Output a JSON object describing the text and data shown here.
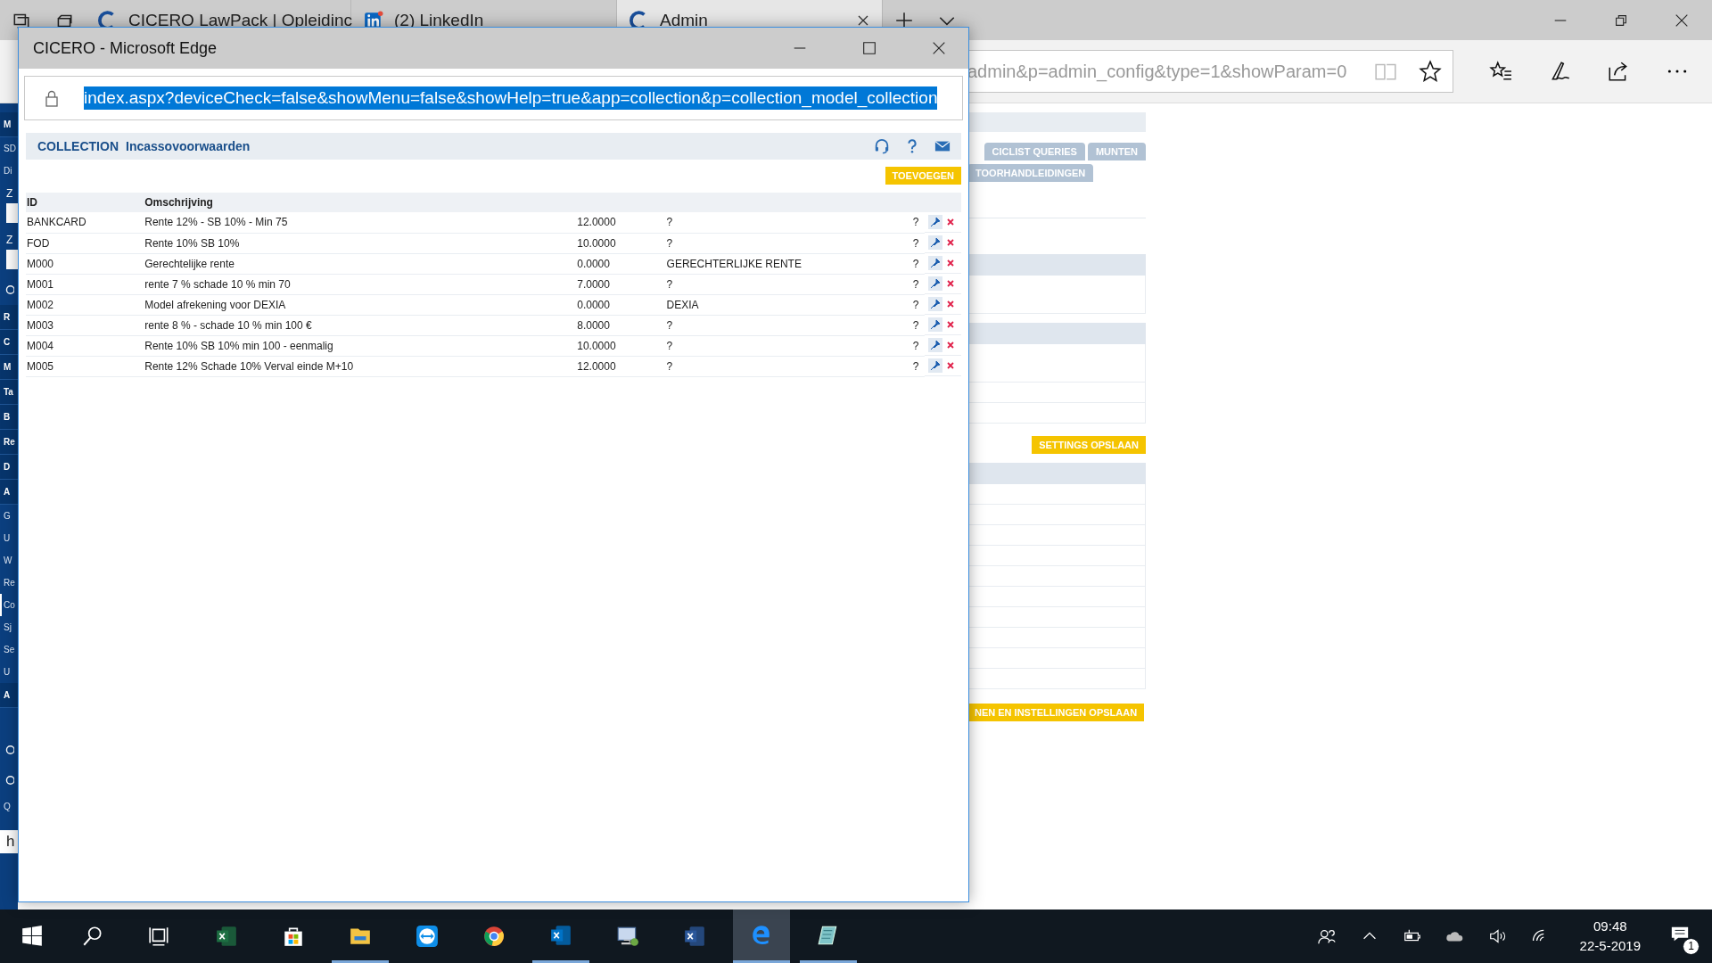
{
  "browser": {
    "tabs": [
      {
        "title": "CICERO LawPack | Opleidinc",
        "selected": false
      },
      {
        "title": "(2) LinkedIn",
        "selected": false
      },
      {
        "title": "Admin",
        "selected": true
      }
    ],
    "address": "admin&p=admin_config&type=1&showParam=0"
  },
  "sidebar": {
    "items": [
      {
        "label": "M",
        "kind": "header"
      },
      {
        "label": "SD",
        "kind": "text"
      },
      {
        "label": "Di",
        "kind": "text"
      },
      {
        "label": "Z",
        "kind": "field"
      },
      {
        "label": "Z",
        "kind": "field"
      },
      {
        "kind": "icon"
      },
      {
        "label": "R",
        "kind": "header"
      },
      {
        "label": "C",
        "kind": "header"
      },
      {
        "label": "M",
        "kind": "header"
      },
      {
        "label": "Ta",
        "kind": "header"
      },
      {
        "label": "B",
        "kind": "header"
      },
      {
        "label": "Re",
        "kind": "header"
      },
      {
        "label": "D",
        "kind": "header"
      },
      {
        "label": "A",
        "kind": "header"
      },
      {
        "label": "G",
        "kind": "text",
        "selected": false
      },
      {
        "label": "U",
        "kind": "text",
        "selected": false
      },
      {
        "label": "W",
        "kind": "text",
        "selected": false
      },
      {
        "label": "Re",
        "kind": "text",
        "selected": false
      },
      {
        "label": "Co",
        "kind": "text",
        "selected": true
      },
      {
        "label": "Sj",
        "kind": "text",
        "selected": false
      },
      {
        "label": "Se",
        "kind": "text",
        "selected": false
      },
      {
        "label": "U",
        "kind": "text",
        "selected": false
      },
      {
        "label": "A",
        "kind": "header"
      },
      {
        "kind": "gap"
      },
      {
        "kind": "icon"
      },
      {
        "kind": "icon"
      },
      {
        "label": "Q",
        "kind": "text"
      },
      {
        "label": "h",
        "kind": "input"
      }
    ]
  },
  "background_page": {
    "tabs": [
      "CICLIST QUERIES",
      "MUNTEN",
      "TOORHANDLEIDINGEN"
    ],
    "save_button": "SETTINGS OPSLAAN",
    "save_all_button": "NEN EN INSTELLINGEN OPSLAAN"
  },
  "popup": {
    "title": "CICERO - Microsoft Edge",
    "url": "index.aspx?deviceCheck=false&showMenu=false&showHelp=true&app=collection&p=collection_model_collection",
    "url_selected": true,
    "heading": {
      "app": "COLLECTION",
      "page": "Incassovoorwaarden"
    },
    "add_button": "TOEVOEGEN",
    "columns": [
      "ID",
      "Omschrijving"
    ],
    "rows": [
      {
        "id": "BANKCARD",
        "description": "Rente 12% - SB 10% - Min 75",
        "rate": "12.0000",
        "column_4": "?",
        "help": "?"
      },
      {
        "id": "FOD",
        "description": "Rente 10% SB 10%",
        "rate": "10.0000",
        "column_4": "?",
        "help": "?"
      },
      {
        "id": "M000",
        "description": "Gerechtelijke rente",
        "rate": "0.0000",
        "column_4": "GERECHTERLIJKE RENTE",
        "help": "?"
      },
      {
        "id": "M001",
        "description": "rente 7 % schade 10 % min 70",
        "rate": "7.0000",
        "column_4": "?",
        "help": "?"
      },
      {
        "id": "M002",
        "description": "Model afrekening voor DEXIA",
        "rate": "0.0000",
        "column_4": "DEXIA",
        "help": "?"
      },
      {
        "id": "M003",
        "description": "rente 8 % - schade 10 % min 100 €",
        "rate": "8.0000",
        "column_4": "?",
        "help": "?"
      },
      {
        "id": "M004",
        "description": "Rente 10% SB 10% min 100 - eenmalig",
        "rate": "10.0000",
        "column_4": "?",
        "help": "?"
      },
      {
        "id": "M005",
        "description": "Rente 12% Schade 10% Verval einde M+10",
        "rate": "12.0000",
        "column_4": "?",
        "help": "?"
      }
    ]
  },
  "taskbar": {
    "apps": [
      {
        "kind": "search",
        "running": false,
        "selected": false
      },
      {
        "kind": "taskview",
        "running": false,
        "selected": false
      },
      {
        "kind": "excel",
        "running": false,
        "selected": false
      },
      {
        "kind": "store",
        "running": false,
        "selected": false
      },
      {
        "kind": "explorer",
        "running": true,
        "selected": false
      },
      {
        "kind": "teamviewer",
        "running": false,
        "selected": false
      },
      {
        "kind": "chrome",
        "running": false,
        "selected": false
      },
      {
        "kind": "outlook",
        "running": true,
        "selected": false
      },
      {
        "kind": "remote",
        "running": false,
        "selected": false
      },
      {
        "kind": "word",
        "running": false,
        "selected": false
      },
      {
        "kind": "edge",
        "running": true,
        "selected": true
      },
      {
        "kind": "notepad",
        "running": true,
        "selected": false
      }
    ],
    "time": "09:48",
    "date": "22-5-2019",
    "notifications": "1"
  }
}
